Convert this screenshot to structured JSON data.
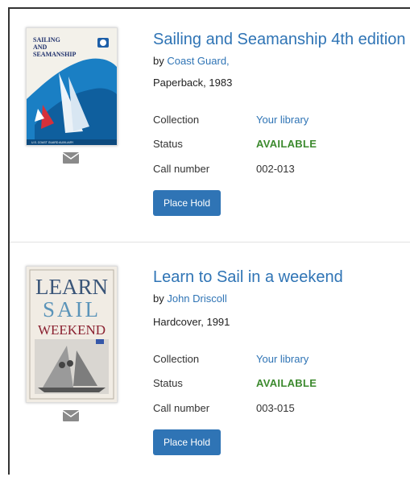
{
  "records": [
    {
      "title": "Sailing and Seamanship 4th edition",
      "by_prefix": "by ",
      "author": "Coast Guard,",
      "format": "Paperback, 1983",
      "cover": {
        "line1": "SAILING",
        "line2": "AND",
        "line3": "SEAMANSHIP",
        "footer": "U.S. COAST GUARD AUXILIARY",
        "colors": {
          "sea": "#1a7fc4",
          "sky": "#f3f1ea",
          "sail": "#ffffff",
          "text": "#1d2f6b",
          "accent": "#d6303a"
        }
      },
      "details": [
        {
          "label": "Collection",
          "value": "Your library",
          "kind": "link"
        },
        {
          "label": "Status",
          "value": "AVAILABLE",
          "kind": "status"
        },
        {
          "label": "Call number",
          "value": "002-013",
          "kind": "text"
        }
      ],
      "hold_label": "Place Hold",
      "mail_icon": "envelope-icon"
    },
    {
      "title": "Learn to Sail in a weekend",
      "by_prefix": "by ",
      "author": "John Driscoll",
      "format": "Hardcover, 1991",
      "cover": {
        "line1": "LEARN",
        "line2": "SAIL",
        "line3": "WEEKEND",
        "colors": {
          "bg": "#f1ece4",
          "learn": "#3a5578",
          "sail": "#5b94b9",
          "weekend": "#8b2231",
          "photo": "#8c8c8c"
        }
      },
      "details": [
        {
          "label": "Collection",
          "value": "Your library",
          "kind": "link"
        },
        {
          "label": "Status",
          "value": "AVAILABLE",
          "kind": "status"
        },
        {
          "label": "Call number",
          "value": "003-015",
          "kind": "text"
        }
      ],
      "hold_label": "Place Hold",
      "mail_icon": "envelope-icon"
    }
  ],
  "colors": {
    "link": "#2f74b5",
    "available": "#3c8a2e",
    "button": "#2f74b5",
    "mail_icon": "#8a8a8a"
  }
}
